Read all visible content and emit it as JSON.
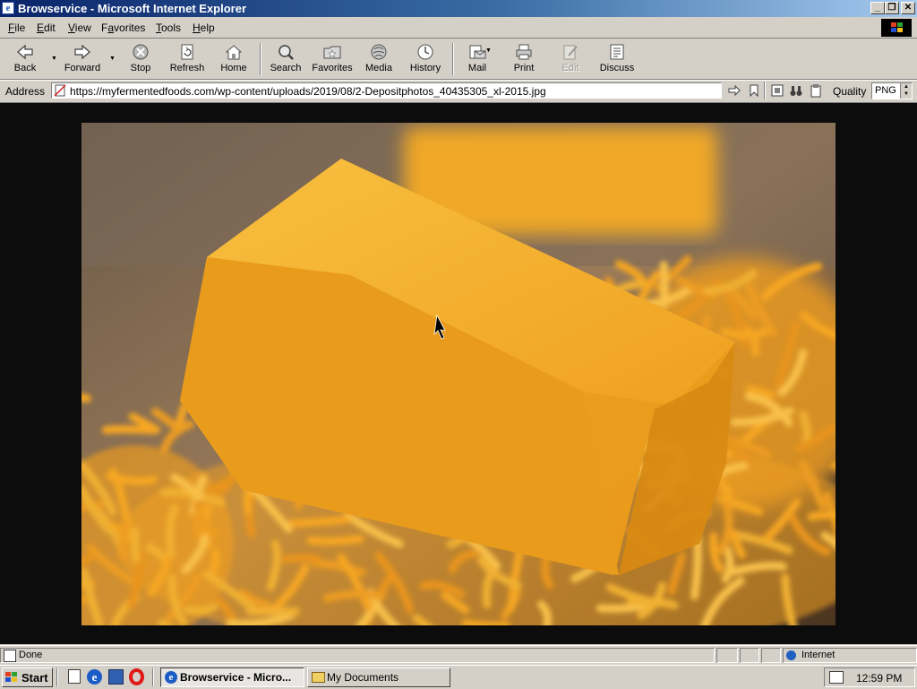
{
  "window": {
    "title": "Browservice - Microsoft Internet Explorer",
    "app_icon": "ie-icon",
    "controls": [
      "minimize-icon",
      "restore-icon",
      "close-icon"
    ]
  },
  "menu": {
    "items": [
      {
        "label": "File",
        "accel": "F"
      },
      {
        "label": "Edit",
        "accel": "E"
      },
      {
        "label": "View",
        "accel": "V"
      },
      {
        "label": "Favorites",
        "accel": "a"
      },
      {
        "label": "Tools",
        "accel": "T"
      },
      {
        "label": "Help",
        "accel": "H"
      }
    ]
  },
  "toolbar": {
    "back": "Back",
    "forward": "Forward",
    "stop": "Stop",
    "refresh": "Refresh",
    "home": "Home",
    "search": "Search",
    "favorites": "Favorites",
    "media": "Media",
    "history": "History",
    "mail": "Mail",
    "print": "Print",
    "edit": "Edit",
    "discuss": "Discuss"
  },
  "address": {
    "label": "Address",
    "url": "https://myfermentedfoods.com/wp-content/uploads/2019/08/2-Depositphotos_40435305_xl-2015.jpg",
    "quality_label": "Quality",
    "quality_value": "PNG"
  },
  "page": {
    "image_subject": "block of cheddar cheese on shredded cheddar",
    "colors": {
      "background": "#0c0c0c",
      "cheese": "#f0a020"
    }
  },
  "status": {
    "text": "Done",
    "zone": "Internet"
  },
  "taskbar": {
    "start": "Start",
    "tasks": [
      {
        "label": "Browservice - Micro...",
        "active": true
      },
      {
        "label": "My Documents",
        "active": false
      }
    ],
    "clock": "12:59 PM"
  }
}
